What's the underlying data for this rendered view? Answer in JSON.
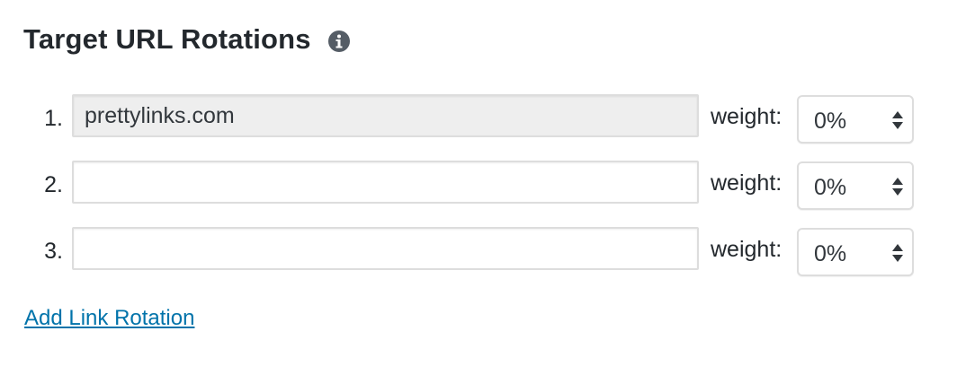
{
  "section": {
    "title": "Target URL Rotations",
    "info_icon": "info-icon"
  },
  "rotations": [
    {
      "number": "1.",
      "url": "prettylinks.com",
      "placeholder": "",
      "weight_label": "weight:",
      "weight": "0%"
    },
    {
      "number": "2.",
      "url": "",
      "placeholder": "",
      "weight_label": "weight:",
      "weight": "0%"
    },
    {
      "number": "3.",
      "url": "",
      "placeholder": "",
      "weight_label": "weight:",
      "weight": "0%"
    }
  ],
  "actions": {
    "add_rotation_label": "Add Link Rotation"
  },
  "colors": {
    "text": "#23282d",
    "link": "#0073aa",
    "input_border": "#dddddd",
    "filled_input_bg": "#eeeeee",
    "icon": "#555d66"
  }
}
